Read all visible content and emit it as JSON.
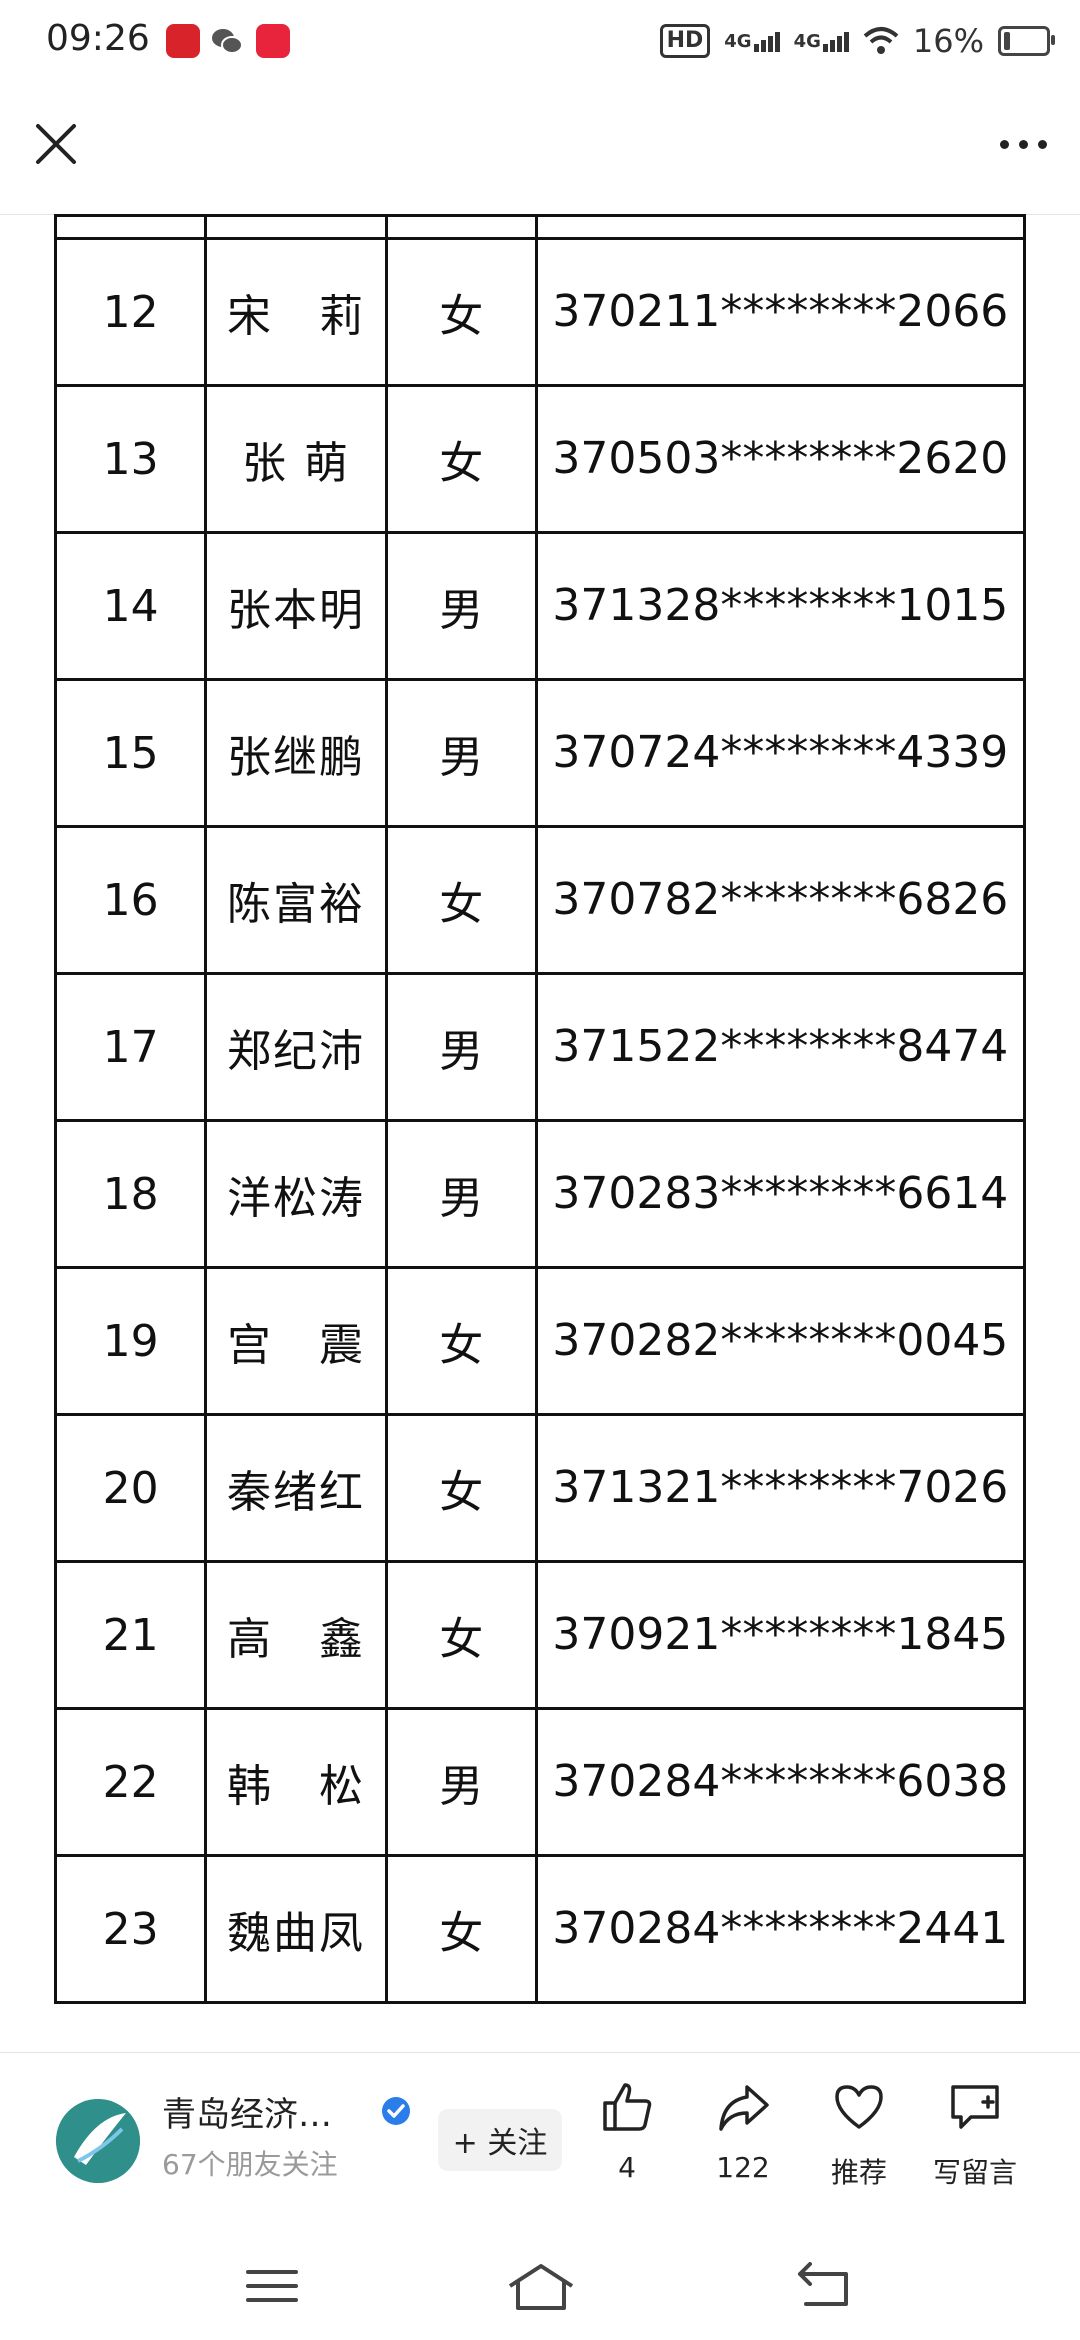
{
  "status_bar": {
    "time": "09:26",
    "hd_label": "HD",
    "signal_1": "4G",
    "signal_2": "4G",
    "battery": "16%",
    "battery_level": 0.16,
    "app_icons": [
      "news-app-icon",
      "wechat-icon",
      "xiaohongshu-icon"
    ]
  },
  "top_nav": {
    "close_icon": "close-icon",
    "more_icon": "more-horizontal-icon"
  },
  "table": {
    "rows": [
      {
        "no": "12",
        "name": "宋　莉",
        "sex": "女",
        "id": "370211********2066"
      },
      {
        "no": "13",
        "name": "张 萌",
        "sex": "女",
        "id": "370503********2620"
      },
      {
        "no": "14",
        "name": "张本明",
        "sex": "男",
        "id": "371328********1015"
      },
      {
        "no": "15",
        "name": "张继鹏",
        "sex": "男",
        "id": "370724********4339"
      },
      {
        "no": "16",
        "name": "陈富裕",
        "sex": "女",
        "id": "370782********6826"
      },
      {
        "no": "17",
        "name": "郑纪沛",
        "sex": "男",
        "id": "371522********8474"
      },
      {
        "no": "18",
        "name": "洋松涛",
        "sex": "男",
        "id": "370283********6614"
      },
      {
        "no": "19",
        "name": "宫　震",
        "sex": "女",
        "id": "370282********0045"
      },
      {
        "no": "20",
        "name": "秦绪红",
        "sex": "女",
        "id": "371321********7026"
      },
      {
        "no": "21",
        "name": "高　鑫",
        "sex": "女",
        "id": "370921********1845"
      },
      {
        "no": "22",
        "name": "韩　松",
        "sex": "男",
        "id": "370284********6038"
      },
      {
        "no": "23",
        "name": "魏曲凤",
        "sex": "女",
        "id": "370284********2441"
      }
    ]
  },
  "bottom_bar": {
    "author_name": "青岛经济…",
    "followers": "67个朋友关注",
    "follow_label": "+ 关注",
    "like_count": "4",
    "share_count": "122",
    "recommend_label": "推荐",
    "comment_label": "写留言",
    "accent_color": "#2f8f8a",
    "verified_color": "#2b7de9"
  },
  "nav_bar": {
    "icons": [
      "menu-icon",
      "home-icon",
      "back-icon"
    ]
  }
}
